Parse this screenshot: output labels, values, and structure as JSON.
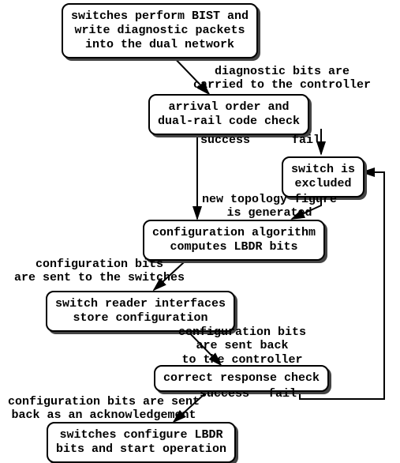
{
  "nodes": {
    "n1": "switches perform BIST and\nwrite diagnostic packets\ninto the dual network",
    "n2": "arrival order and\ndual-rail code check",
    "n3": "switch is\nexcluded",
    "n4": "configuration algorithm\ncomputes LBDR bits",
    "n5": "switch reader interfaces\nstore configuration",
    "n6": "correct response check",
    "n7": "switches configure LBDR\nbits and start operation"
  },
  "labels": {
    "l1": "diagnostic bits are\ncarried to the controller",
    "l2": "success",
    "l3": "fail",
    "l4": "new topology figure\nis generated",
    "l5": "configuration bits\nare sent to the switches",
    "l6": "configuration bits\nare sent back\nto the controller",
    "l7": "success",
    "l8": "fail",
    "l9": "configuration bits are sent\nback as an acknowledgement"
  },
  "chart_data": {
    "type": "flowchart",
    "nodes": [
      {
        "id": "n1",
        "text": "switches perform BIST and write diagnostic packets into the dual network"
      },
      {
        "id": "n2",
        "text": "arrival order and dual-rail code check"
      },
      {
        "id": "n3",
        "text": "switch is excluded"
      },
      {
        "id": "n4",
        "text": "configuration algorithm computes LBDR bits"
      },
      {
        "id": "n5",
        "text": "switch reader interfaces store configuration"
      },
      {
        "id": "n6",
        "text": "correct response check"
      },
      {
        "id": "n7",
        "text": "switches configure LBDR bits and start operation"
      }
    ],
    "edges": [
      {
        "from": "n1",
        "to": "n2",
        "label": "diagnostic bits are carried to the controller"
      },
      {
        "from": "n2",
        "to": "n4",
        "label": "success"
      },
      {
        "from": "n2",
        "to": "n3",
        "label": "fail"
      },
      {
        "from": "n3",
        "to": "n4",
        "label": "new topology figure is generated"
      },
      {
        "from": "n4",
        "to": "n5",
        "label": "configuration bits are sent to the switches"
      },
      {
        "from": "n5",
        "to": "n6",
        "label": "configuration bits are sent back to the controller"
      },
      {
        "from": "n6",
        "to": "n7",
        "label": "success / configuration bits are sent back as an acknowledgement"
      },
      {
        "from": "n6",
        "to": "n3",
        "label": "fail"
      }
    ]
  }
}
